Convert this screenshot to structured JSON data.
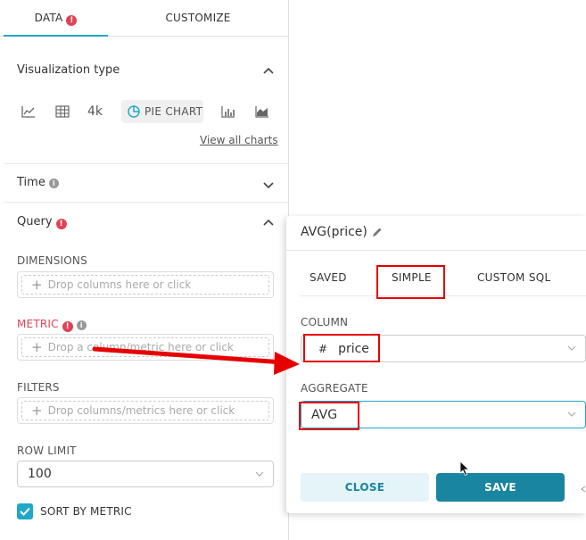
{
  "tabs": {
    "data": "DATA",
    "customize": "CUSTOMIZE"
  },
  "viz": {
    "title": "Visualization type",
    "pie_label": "PIE CHART",
    "bignum_label": "4k",
    "view_all": "View all charts"
  },
  "time": {
    "title": "Time"
  },
  "query": {
    "title": "Query",
    "dimensions_label": "DIMENSIONS",
    "dimensions_placeholder": "Drop columns here or click",
    "metric_label": "METRIC",
    "metric_placeholder": "Drop a column/metric here or click",
    "filters_label": "FILTERS",
    "filters_placeholder": "Drop columns/metrics here or click",
    "row_limit_label": "ROW LIMIT",
    "row_limit_value": "100",
    "sort_label": "SORT BY METRIC"
  },
  "popover": {
    "title": "AVG(price)",
    "tabs": {
      "saved": "SAVED",
      "simple": "SIMPLE",
      "custom_sql": "CUSTOM SQL"
    },
    "column_label": "COLUMN",
    "column_type_icon": "#",
    "column_value": "price",
    "aggregate_label": "AGGREGATE",
    "aggregate_value": "AVG",
    "close": "CLOSE",
    "save": "SAVE"
  },
  "colors": {
    "accent": "#20a7c9",
    "primary": "#1a85a0",
    "error": "#e04355",
    "highlight": "#e60000"
  }
}
